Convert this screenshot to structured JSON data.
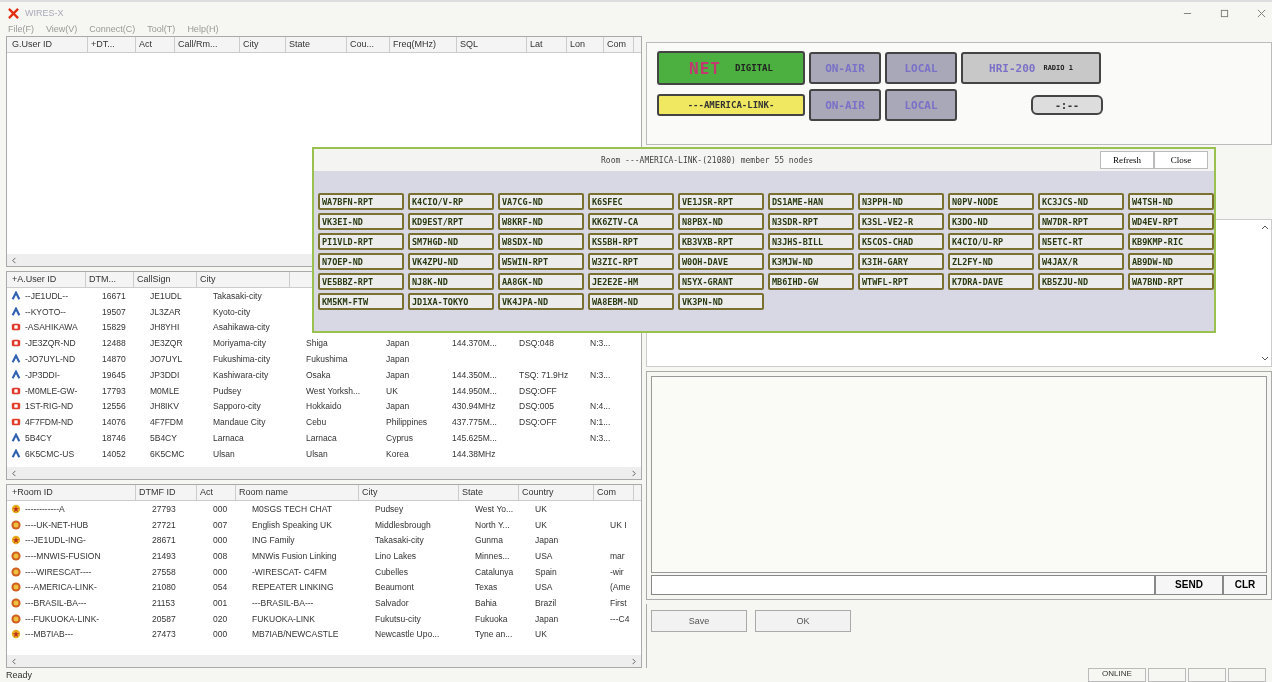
{
  "window": {
    "title": "WIRES-X"
  },
  "menu": [
    "File(F)",
    "View(V)",
    "Connect(C)",
    "Tool(T)",
    "Help(H)"
  ],
  "group_table": {
    "columns": [
      "G.User ID",
      "+DT...",
      "Act",
      "Call/Rm...",
      "City",
      "State",
      "Cou...",
      "Freq(MHz)",
      "SQL",
      "Lat",
      "Lon",
      "Com"
    ]
  },
  "user_table": {
    "columns": [
      "+A.User ID",
      "DTM...",
      "CallSign",
      "City"
    ],
    "rows": [
      {
        "kind": "analog",
        "cells": [
          "--JE1UDL--",
          "16671",
          "JE1UDL",
          "Takasaki-city"
        ]
      },
      {
        "kind": "analog",
        "cells": [
          "--KYOTO--",
          "19507",
          "JL3ZAR",
          "Kyoto-city"
        ]
      },
      {
        "kind": "digital",
        "cells": [
          "-ASAHIKAWA",
          "15829",
          "JH8YHI",
          "Asahikawa-city"
        ]
      },
      {
        "kind": "digital",
        "cells": [
          "-JE3ZQR-ND",
          "12488",
          "JE3ZQR",
          "Moriyama-city",
          "Shiga",
          "Japan",
          "144.370M...",
          "DSQ:048",
          "N:3..."
        ]
      },
      {
        "kind": "analog",
        "cells": [
          "-JO7UYL-ND",
          "14870",
          "JO7UYL",
          "Fukushima-city",
          "Fukushima",
          "Japan"
        ]
      },
      {
        "kind": "analog",
        "cells": [
          "-JP3DDI-",
          "19645",
          "JP3DDI",
          "Kashiwara-city",
          "Osaka",
          "Japan",
          "144.350M...",
          "TSQ: 71.9Hz",
          "N:3..."
        ]
      },
      {
        "kind": "digital",
        "cells": [
          "-M0MLE-GW-",
          "17793",
          "M0MLE",
          "Pudsey",
          "West Yorksh...",
          "UK",
          "144.950M...",
          "DSQ:OFF"
        ]
      },
      {
        "kind": "digital",
        "cells": [
          "1ST-RIG-ND",
          "12556",
          "JH8IKV",
          "Sapporo-city",
          "Hokkaido",
          "Japan",
          "430.94MHz",
          "DSQ:005",
          "N:4..."
        ]
      },
      {
        "kind": "digital",
        "cells": [
          "4F7FDM-ND",
          "14076",
          "4F7FDM",
          "Mandaue City",
          "Cebu",
          "Philippines",
          "437.775M...",
          "DSQ:OFF",
          "N:1..."
        ]
      },
      {
        "kind": "analog",
        "cells": [
          "5B4CY",
          "18746",
          "5B4CY",
          "Larnaca",
          "Larnaca",
          "Cyprus",
          "145.625M...",
          null,
          "N:3..."
        ]
      },
      {
        "kind": "analog",
        "cells": [
          "6K5CMC-US",
          "14052",
          "6K5CMC",
          "Ulsan",
          "Ulsan",
          "Korea",
          "144.38MHz"
        ]
      }
    ]
  },
  "room_table": {
    "columns": [
      "+Room ID",
      "DTMF ID",
      "Act",
      "Room name",
      "City",
      "State",
      "Country",
      "Com"
    ],
    "rows": [
      {
        "kind": "star",
        "cells": [
          "------------A",
          "27793",
          "000",
          "M0SGS TECH CHAT",
          "Pudsey",
          "West Yo...",
          "UK"
        ]
      },
      {
        "kind": "ball",
        "cells": [
          "----UK-NET-HUB",
          "27721",
          "007",
          "English Speaking UK",
          "Middlesbrough",
          "North Y...",
          "UK",
          "UK I"
        ]
      },
      {
        "kind": "star",
        "cells": [
          "---JE1UDL-ING-",
          "28671",
          "000",
          "ING Family",
          "Takasaki-city",
          "Gunma",
          "Japan"
        ]
      },
      {
        "kind": "ball",
        "cells": [
          "----MNWIS-FUSION",
          "21493",
          "008",
          "MNWis Fusion Linking",
          "Lino Lakes",
          "Minnes...",
          "USA",
          "mar"
        ]
      },
      {
        "kind": "ball",
        "cells": [
          "----WIRESCAT----",
          "27558",
          "000",
          "-WIRESCAT- C4FM",
          "Cubelles",
          "Catalunya",
          "Spain",
          "-wir"
        ]
      },
      {
        "kind": "ball",
        "cells": [
          "---AMERICA-LINK-",
          "21080",
          "054",
          "REPEATER LINKING",
          "Beaumont",
          "Texas",
          "USA",
          "(Ame"
        ]
      },
      {
        "kind": "ball",
        "cells": [
          "---BRASIL-BA---",
          "21153",
          "001",
          "---BRASIL-BA---",
          "Salvador",
          "Bahia",
          "Brazil",
          "First"
        ]
      },
      {
        "kind": "ball",
        "cells": [
          "---FUKUOKA-LINK-",
          "20587",
          "020",
          "FUKUOKA-LINK",
          "Fukutsu-city",
          "Fukuoka",
          "Japan",
          "---C4"
        ]
      },
      {
        "kind": "star",
        "cells": [
          "---MB7IAB---",
          "27473",
          "000",
          "MB7IAB/NEWCASTLE",
          "Newcastle Upo...",
          "Tyne an...",
          "UK"
        ]
      }
    ]
  },
  "indicators": [
    [
      {
        "kind": "net",
        "label": "NET",
        "sub": "DIGITAL"
      },
      {
        "kind": "lamp",
        "label": "ON-AIR",
        "on": false
      },
      {
        "kind": "lamp",
        "label": "LOCAL",
        "on": false
      },
      {
        "kind": "radio",
        "label": "HRI-200",
        "sub": "RADIO 1"
      }
    ],
    [
      {
        "kind": "room",
        "label": "---AMERICA-LINK-"
      },
      {
        "kind": "lamp",
        "label": "ON-AIR",
        "on": false
      },
      {
        "kind": "lamp",
        "label": "LOCAL",
        "on": false
      },
      {
        "kind": "timer",
        "label": "-:--"
      }
    ]
  ],
  "member_popup": {
    "title": "Room ---AMERICA-LINK-(21080) member 55 nodes",
    "buttons": [
      "Refresh",
      "Close"
    ],
    "nodes": [
      "WA7BFN-RPT",
      "K4CIO/V-RP",
      "VA7CG-ND",
      "K6SFEC",
      "VE1JSR-RPT",
      "DS1AME-HAN",
      "N3PPH-ND",
      "N0PV-NODE",
      "KC3JCS-ND",
      "W4TSH-ND",
      "VK3EI-ND",
      "KD9EST/RPT",
      "W8KRF-ND",
      "KK6ZTV-CA",
      "N8PBX-ND",
      "N3SDR-RPT",
      "K3SL-VE2-R",
      "K3DO-ND",
      "NW7DR-RPT",
      "WD4EV-RPT",
      "PI1VLD-RPT",
      "SM7HGD-ND",
      "W8SDX-ND",
      "KS5BH-RPT",
      "KB3VXB-RPT",
      "N3JHS-BILL",
      "K5COS-CHAD",
      "K4CIO/U-RP",
      "N5ETC-RT",
      "KB9KMP-RIC",
      "N7OEP-ND",
      "VK4ZPU-ND",
      "W5WIN-RPT",
      "W3ZIC-RPT",
      "W0OH-DAVE",
      "K3MJW-ND",
      "K3IH-GARY",
      "ZL2FY-ND",
      "W4JAX/R",
      "AB9DW-ND",
      "VE5BBZ-RPT",
      "NJ8K-ND",
      "AA8GK-ND",
      "JE2E2E-HM",
      "N5YX-GRANT",
      "MB6IHD-GW",
      "WTWFL-RPT",
      "K7DRA-DAVE",
      "KB5ZJU-ND",
      "WA7BND-RPT",
      "KM5KM-FTW",
      "JD1XA-TOKYO",
      "VK4JPA-ND",
      "WA8EBM-ND",
      "VK3PN-ND"
    ]
  },
  "chat": {
    "buttons": [
      "SEND",
      "CLR"
    ]
  },
  "actions": [
    "Save",
    "OK"
  ],
  "status_bar": {
    "text": "Ready",
    "panes": [
      "ONLINE"
    ]
  }
}
